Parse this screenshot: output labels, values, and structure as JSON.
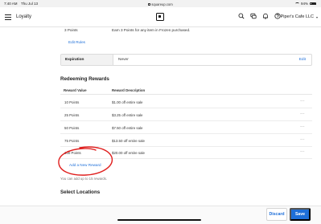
{
  "status_bar": {
    "time": "7:40 AM",
    "date": "Thu Jul 13",
    "url": "squareup.com",
    "battery": "94%"
  },
  "app_bar": {
    "title": "Loyalty",
    "account_name": "Piper's Cafe LLC",
    "icons": [
      "menu-icon",
      "square-logo-icon",
      "search-icon",
      "messages-icon",
      "bell-icon",
      "help-icon"
    ]
  },
  "earning_rule": {
    "points": "3 Points",
    "description": "Earn 3 Points for any item in Frozen purchased."
  },
  "edit_rules_link": "Edit Rules",
  "expiration": {
    "label": "Expiration",
    "value": "Never",
    "edit_label": "Edit"
  },
  "redeeming": {
    "title": "Redeeming Rewards",
    "columns": [
      "Reward Value",
      "Reward Description"
    ],
    "rows": [
      {
        "value": "10 Points",
        "description": "$1.00 off entire sale"
      },
      {
        "value": "25 Points",
        "description": "$3.25 off entire sale"
      },
      {
        "value": "50 Points",
        "description": "$7.50 off entire sale"
      },
      {
        "value": "75 Points",
        "description": "$13.50 off entire sale"
      },
      {
        "value": "100 Points",
        "description": "$20.00 off entire sale"
      }
    ],
    "row_menu_glyph": "···",
    "add_link": "Add a New Reward",
    "limit_note": "You can add up to 15 rewards."
  },
  "select_locations": {
    "title": "Select Locations"
  },
  "footer": {
    "discard_label": "Discard",
    "save_label": "Save"
  },
  "colors": {
    "accent": "#1e6fd9",
    "annotation": "#e0201f"
  }
}
